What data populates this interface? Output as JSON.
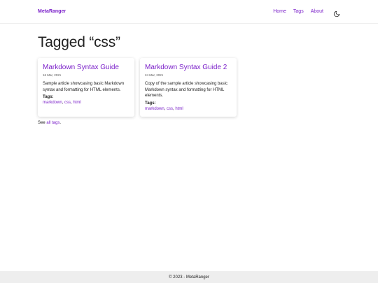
{
  "header": {
    "brand": "MetaRanger",
    "nav": [
      {
        "label": "Home"
      },
      {
        "label": "Tags"
      },
      {
        "label": "About"
      }
    ],
    "theme_icon": "moon-icon"
  },
  "main": {
    "title": "Tagged “css”",
    "cards": [
      {
        "title": "Markdown Syntax Guide",
        "date": "16 Mar, 2021",
        "description": "Sample article showcasing basic Markdown syntax and formatting for HTML elements.",
        "tags_label": "Tags:",
        "tags": [
          "markdown",
          "css",
          "html"
        ]
      },
      {
        "title": "Markdown Syntax Guide 2",
        "date": "24 Mar, 2021",
        "description": "Copy of the sample article showcasing basic Markdown syntax and formatting for HTML elements.",
        "tags_label": "Tags:",
        "tags": [
          "markdown",
          "css",
          "html"
        ]
      }
    ],
    "see_all_prefix": "See ",
    "see_all_link": "all tags",
    "see_all_suffix": "."
  },
  "footer": {
    "text": "© 2023 - MetaRanger"
  },
  "colors": {
    "accent": "#7a1fc9",
    "footer_bg": "#eeeeee"
  }
}
